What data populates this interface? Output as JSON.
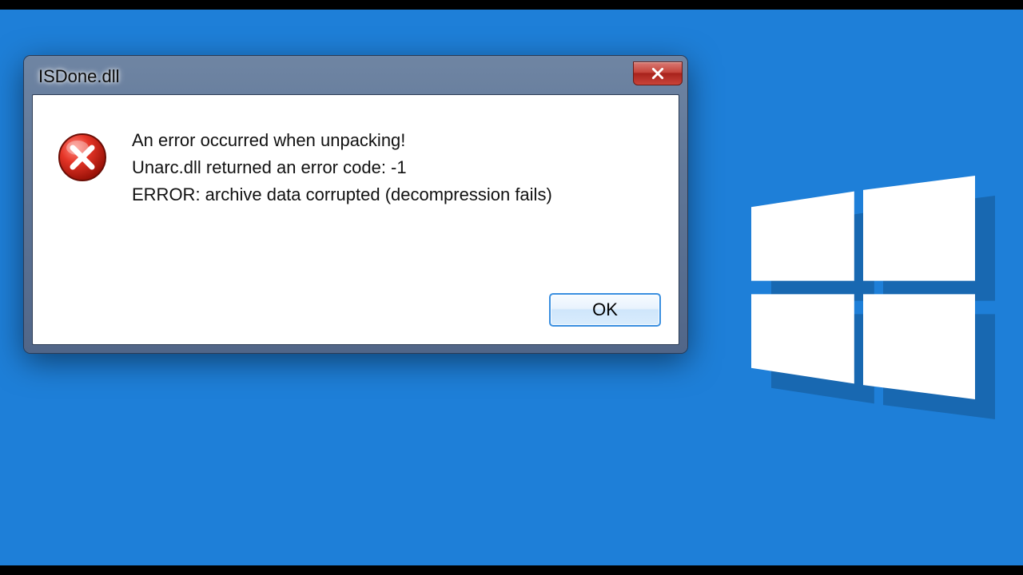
{
  "dialog": {
    "title": "ISDone.dll",
    "message_line1": "An error occurred when unpacking!",
    "message_line2": "Unarc.dll returned an error code: -1",
    "message_line3": "ERROR: archive data corrupted (decompression fails)",
    "ok_label": "OK"
  },
  "colors": {
    "background": "#1e7fd8",
    "frame_start": "#6f85a3",
    "frame_end": "#516688",
    "close_red": "#c5443b",
    "ok_border": "#3a8fe0"
  }
}
